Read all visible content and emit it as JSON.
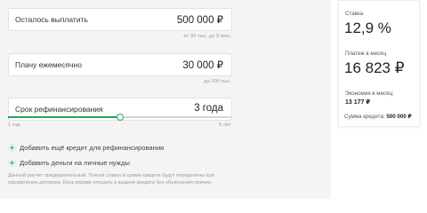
{
  "loan": {
    "remaining": {
      "label": "Осталось выплатить",
      "value": "500 000 ₽",
      "hint": "от 30 тыс. до 3 млн."
    },
    "monthly": {
      "label": "Плачу ежемесячно",
      "value": "30 000 ₽",
      "hint": "до 200 тыс."
    },
    "term": {
      "label": "Срок рефинансирования",
      "value": "3 года",
      "min_label": "1 год",
      "max_label": "5 лет",
      "fraction": 0.5
    }
  },
  "actions": {
    "add_credit": "Добавить ещё кредит для рефинансирования",
    "add_money": "Добавить деньги на личные нужды"
  },
  "disclaimer": "Данный расчет предварительный. Точная ставка и сумма кредита будут определены при оформлении договора. Банк вправе отказать в выдаче кредита без объяснения причин.",
  "summary": {
    "rate_label": "Ставка",
    "rate_value": "12,9 %",
    "payment_label": "Платеж в месяц",
    "payment_value": "16 823 ₽",
    "savings_label": "Экономия в месяц:",
    "savings_value": "13 177 ₽",
    "total_label": "Сумма кредита:",
    "total_value": "500 000 ₽"
  },
  "colors": {
    "accent": "#23a45a",
    "panel_bg": "#f4f4f4"
  }
}
